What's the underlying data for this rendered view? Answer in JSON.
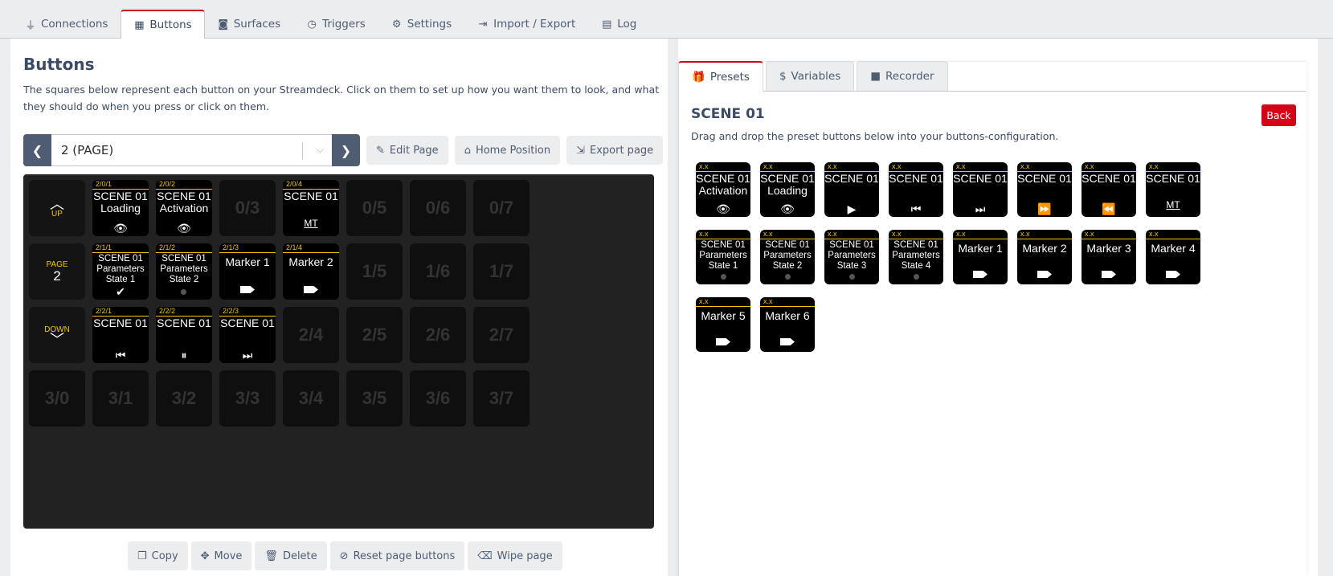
{
  "nav": {
    "tabs": [
      {
        "label": "Connections",
        "icon": "plug-icon"
      },
      {
        "label": "Buttons",
        "icon": "calendar-grid-icon"
      },
      {
        "label": "Surfaces",
        "icon": "gamepad-icon"
      },
      {
        "label": "Triggers",
        "icon": "clock-icon"
      },
      {
        "label": "Settings",
        "icon": "gear-icon"
      },
      {
        "label": "Import / Export",
        "icon": "file-import-icon"
      },
      {
        "label": "Log",
        "icon": "clipboard-icon"
      }
    ],
    "active": "Buttons"
  },
  "buttons_panel": {
    "title": "Buttons",
    "description": "The squares below represent each button on your Streamdeck. Click on them to set up how you want them to look, and what they should do when you press or click on them.",
    "page_select": "2 (PAGE)",
    "edit_page": "Edit Page",
    "home_position": "Home Position",
    "export_page": "Export page",
    "copy": "Copy",
    "move": "Move",
    "delete": "Delete",
    "reset_page_buttons": "Reset page buttons",
    "wipe_page": "Wipe page"
  },
  "grid": {
    "nav": {
      "up": "UP",
      "page_label": "PAGE",
      "page_num": "2",
      "down": "DOWN"
    },
    "empty": [
      "0/3",
      "0/5",
      "0/6",
      "0/7",
      "1/5",
      "1/6",
      "1/7",
      "2/4",
      "2/5",
      "2/6",
      "2/7",
      "3/0",
      "3/1",
      "3/2",
      "3/3",
      "3/4",
      "3/5",
      "3/6",
      "3/7"
    ],
    "buttons": [
      {
        "id": "2/0/1",
        "text": "SCENE 01 Loading",
        "glyph": "👁"
      },
      {
        "id": "2/0/2",
        "text": "SCENE 01 Activation",
        "glyph": "👁"
      },
      {
        "id": "2/0/4",
        "text": "SCENE 01",
        "glyph": "MT"
      },
      {
        "id": "2/1/1",
        "text": "SCENE 01 Parameters State 1",
        "glyph": "✔"
      },
      {
        "id": "2/1/2",
        "text": "SCENE 01 Parameters State 2",
        "glyph": ""
      },
      {
        "id": "2/1/3",
        "text": "Marker 1",
        "glyph": ""
      },
      {
        "id": "2/1/4",
        "text": "Marker 2",
        "glyph": ""
      },
      {
        "id": "2/2/1",
        "text": "SCENE 01",
        "glyph": "⏮"
      },
      {
        "id": "2/2/2",
        "text": "SCENE 01",
        "glyph": "⏸"
      },
      {
        "id": "2/2/3",
        "text": "SCENE 01",
        "glyph": "⏭"
      }
    ]
  },
  "presets_panel": {
    "tabs": [
      {
        "label": "Presets",
        "icon": "gift-icon"
      },
      {
        "label": "Variables",
        "icon": "dollar-icon"
      },
      {
        "label": "Recorder",
        "icon": "video-icon"
      }
    ],
    "title": "SCENE 01",
    "back": "Back",
    "description": "Drag and drop the preset buttons below into your buttons-configuration.",
    "header_label": "x.x",
    "presets": [
      {
        "text": "SCENE 01 Activation",
        "glyph": "👁"
      },
      {
        "text": "SCENE 01 Loading",
        "glyph": "👁"
      },
      {
        "text": "SCENE 01",
        "glyph": "▶"
      },
      {
        "text": "SCENE 01",
        "glyph": "⏮"
      },
      {
        "text": "SCENE 01",
        "glyph": "⏭"
      },
      {
        "text": "SCENE 01",
        "glyph": "⏩"
      },
      {
        "text": "SCENE 01",
        "glyph": "⏪"
      },
      {
        "text": "SCENE 01",
        "glyph": "MT"
      },
      {
        "text": "SCENE 01 Parameters State 1",
        "glyph": ""
      },
      {
        "text": "SCENE 01 Parameters State 2",
        "glyph": ""
      },
      {
        "text": "SCENE 01 Parameters State 3",
        "glyph": ""
      },
      {
        "text": "SCENE 01 Parameters State 4",
        "glyph": ""
      },
      {
        "text": "Marker 1",
        "glyph": ""
      },
      {
        "text": "Marker 2",
        "glyph": ""
      },
      {
        "text": "Marker 3",
        "glyph": ""
      },
      {
        "text": "Marker 4",
        "glyph": ""
      },
      {
        "text": "Marker 5",
        "glyph": ""
      },
      {
        "text": "Marker 6",
        "glyph": ""
      }
    ]
  },
  "colors": {
    "accent": "#d50215",
    "label_yellow": "#f3c600",
    "grid_bg": "#222222"
  }
}
